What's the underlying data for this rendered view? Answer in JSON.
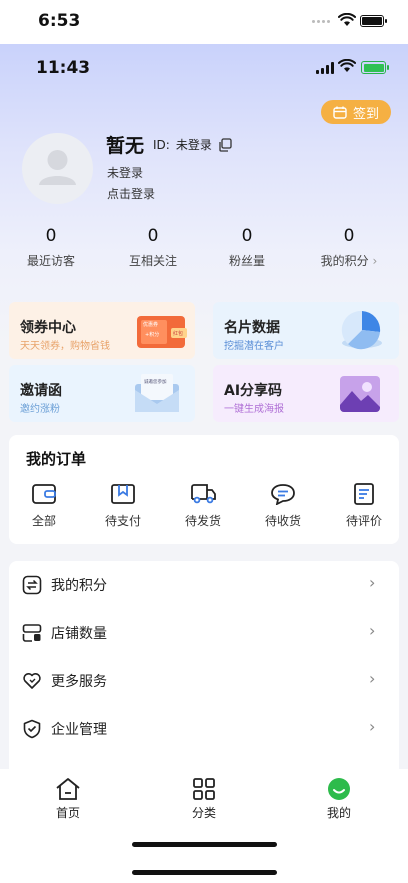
{
  "device": {
    "outer_time": "6:53",
    "inner_time": "11:43"
  },
  "header": {
    "signin_label": "签到"
  },
  "profile": {
    "name": "暂无",
    "id_label": "ID:",
    "id_value": "未登录",
    "status": "未登录",
    "login_prompt": "点击登录"
  },
  "stats": [
    {
      "value": "0",
      "label": "最近访客"
    },
    {
      "value": "0",
      "label": "互相关注"
    },
    {
      "value": "0",
      "label": "粉丝量"
    },
    {
      "value": "0",
      "label": "我的积分"
    }
  ],
  "features": [
    {
      "title": "领券中心",
      "subtitle": "天天领券，购物省钱",
      "art_text_1": "优惠券",
      "art_text_2": "+积分",
      "art_text_3": "红包"
    },
    {
      "title": "名片数据",
      "subtitle": "挖掘潜在客户"
    },
    {
      "title": "邀请函",
      "subtitle": "邀约涨粉",
      "art_text": "诚邀您参加"
    },
    {
      "title": "AI分享码",
      "subtitle": "一键生成海报"
    }
  ],
  "orders": {
    "title": "我的订单",
    "items": [
      {
        "label": "全部",
        "icon": "wallet-icon"
      },
      {
        "label": "待支付",
        "icon": "bookmark-card-icon"
      },
      {
        "label": "待发货",
        "icon": "truck-icon"
      },
      {
        "label": "待收货",
        "icon": "chat-bubble-icon"
      },
      {
        "label": "待评价",
        "icon": "document-icon"
      }
    ]
  },
  "menu": [
    {
      "label": "我的积分",
      "icon": "points-exchange-icon"
    },
    {
      "label": "店铺数量",
      "icon": "store-icon"
    },
    {
      "label": "更多服务",
      "icon": "heart-icon"
    },
    {
      "label": "企业管理",
      "icon": "shield-check-icon"
    }
  ],
  "tabbar": [
    {
      "label": "首页",
      "icon": "home-icon"
    },
    {
      "label": "分类",
      "icon": "grid-icon"
    },
    {
      "label": "我的",
      "icon": "profile-face-icon"
    }
  ],
  "colors": {
    "accent": "#f5b043",
    "tab_active": "#2dbb4b",
    "gradient_top": "#c9d2fb"
  }
}
